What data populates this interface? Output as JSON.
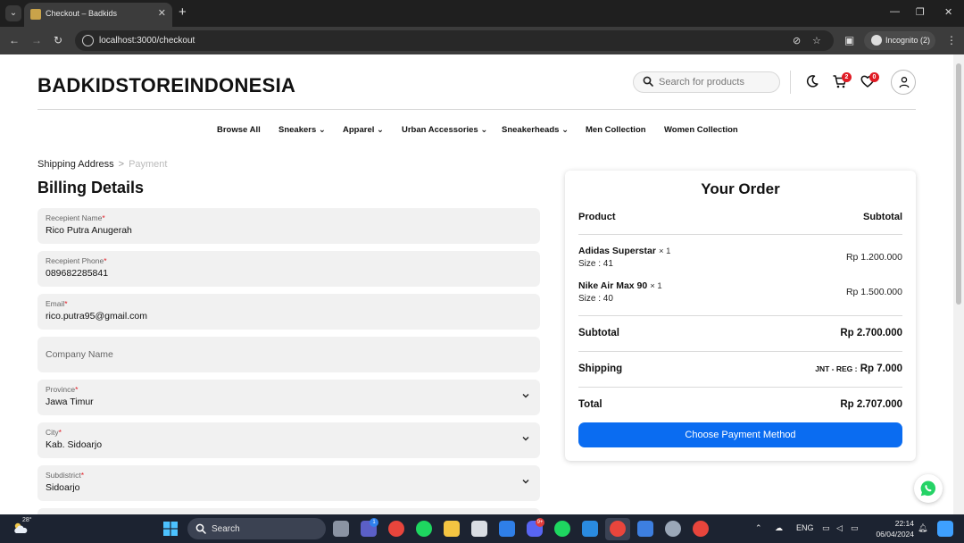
{
  "browser": {
    "tab_title": "Checkout – Badkids",
    "url": "localhost:3000/checkout",
    "incognito_label": "Incognito (2)"
  },
  "header": {
    "brand": "BADKIDSTOREINDONESIA",
    "search_placeholder": "Search for products",
    "cart_count": "2",
    "wishlist_count": "0"
  },
  "nav": {
    "items": [
      {
        "label": "Browse All",
        "has_dropdown": false
      },
      {
        "label": "Sneakers",
        "has_dropdown": true
      },
      {
        "label": "Apparel",
        "has_dropdown": true
      },
      {
        "label": "Urban Accessories",
        "has_dropdown": true
      },
      {
        "label": "Sneakerheads",
        "has_dropdown": true
      },
      {
        "label": "Men Collection",
        "has_dropdown": false
      },
      {
        "label": "Women Collection",
        "has_dropdown": false
      }
    ]
  },
  "breadcrumb": {
    "step1": "Shipping Address",
    "separator": ">",
    "step2": "Payment"
  },
  "billing": {
    "title": "Billing Details",
    "fields": {
      "recipient_name": {
        "label": "Recepient Name",
        "required": "*",
        "value": "Rico Putra Anugerah"
      },
      "recipient_phone": {
        "label": "Recepient Phone",
        "required": "*",
        "value": "089682285841"
      },
      "email": {
        "label": "Email",
        "required": "*",
        "value": "rico.putra95@gmail.com"
      },
      "company": {
        "placeholder": "Company Name"
      },
      "province": {
        "label": "Province",
        "required": "*",
        "value": "Jawa Timur"
      },
      "city": {
        "label": "City",
        "required": "*",
        "value": "Kab. Sidoarjo"
      },
      "subdistrict": {
        "label": "Subdistrict",
        "required": "*",
        "value": "Sidoarjo"
      }
    }
  },
  "order": {
    "title": "Your Order",
    "col_product": "Product",
    "col_subtotal": "Subtotal",
    "items": [
      {
        "name": "Adidas Superstar",
        "qty": "× 1",
        "size": "Size : 41",
        "price": "Rp 1.200.000"
      },
      {
        "name": "Nike Air Max 90",
        "qty": "× 1",
        "size": "Size : 40",
        "price": "Rp 1.500.000"
      }
    ],
    "subtotal_label": "Subtotal",
    "subtotal_value": "Rp 2.700.000",
    "shipping_label": "Shipping",
    "shipping_courier": "JNT - REG :",
    "shipping_value": "Rp 7.000",
    "total_label": "Total",
    "total_value": "Rp 2.707.000",
    "pay_button": "Choose Payment Method"
  },
  "taskbar": {
    "weather_temp": "28°",
    "search_label": "Search",
    "teams_badge": "1",
    "discord_badge": "9+",
    "language": "ENG",
    "time": "22:14",
    "date": "06/04/2024"
  },
  "colors": {
    "accent": "#0a6cf1",
    "badge": "#e01b24",
    "whatsapp": "#25d366"
  }
}
